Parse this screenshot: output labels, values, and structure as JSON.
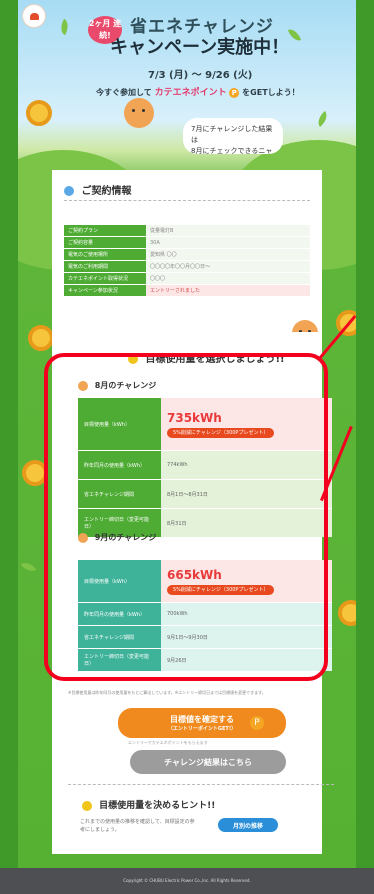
{
  "campaign": {
    "badge": "2ヶ月 連続!",
    "title_line1": "省エネチャレンジ",
    "title_line2": "キャンペーン実施中！",
    "period": "7/3 (月) 〜 9/26 (火)",
    "cta_prefix": "今すぐ参加して",
    "cta_highlight": "カテエネポイント",
    "cta_point": "P",
    "cta_suffix": "をGETしよう！",
    "bubble_line1": "7月にチャレンジした結果は",
    "bubble_line2": "8月にチェックできるニャ"
  },
  "contract": {
    "heading": "ご契約情報",
    "rows": [
      {
        "label": "ご契約プラン",
        "value": "従量電灯B"
      },
      {
        "label": "ご契約容量",
        "value": "30A"
      },
      {
        "label": "電気のご使用場所",
        "value": "愛知県 〇〇"
      },
      {
        "label": "電気のご利用期間",
        "value": "〇〇〇〇年〇〇月〇〇日〜"
      },
      {
        "label": "カテエネポイント取得状況",
        "value": "〇〇〇"
      },
      {
        "label": "キャンペーン参加状況",
        "value": "エントリーされました"
      }
    ]
  },
  "select": {
    "heading": "目標使用量を選択しましょう!!"
  },
  "august": {
    "heading": "8月のチャレンジ",
    "target_label": "目標使用量（kWh）",
    "target_value": "735kWh",
    "chip": "5%削減にチャレンジ（300Pプレゼント）",
    "rows": [
      {
        "label": "昨年同月の使用量（kWh）",
        "value": "774kWh"
      },
      {
        "label": "省エネチャレンジ期間",
        "value": "8月1日〜8月31日"
      },
      {
        "label": "エントリー締切日（変更可能日）",
        "value": "8月31日"
      }
    ]
  },
  "september": {
    "heading": "9月のチャレンジ",
    "target_label": "目標使用量（kWh）",
    "target_value": "665kWh",
    "chip": "5%削減にチャレンジ（300Pプレゼント）",
    "rows": [
      {
        "label": "昨年同月の使用量（kWh）",
        "value": "700kWh"
      },
      {
        "label": "省エネチャレンジ期間",
        "value": "9月1日〜9月30日"
      },
      {
        "label": "エントリー締切日（変更可能日）",
        "value": "9月26日"
      }
    ]
  },
  "notes": "※目標使用量は昨年同月の使用量をもとに算出しています。※エントリー締切日までは目標値を変更できます。",
  "buttons": {
    "confirm_line1": "目標値を確定する",
    "confirm_line2": "（エントリーポイントGET!）",
    "confirm_sub": "エントリーでカテエネポイントをもらえます",
    "confirm_point": "P",
    "results": "チャレンジ結果はこちら"
  },
  "hint": {
    "heading": "目標使用量を決めるヒント!!",
    "text": "これまでの使用量の推移を確認して、目標設定の参考にしましょう。",
    "button": "月別の推移"
  },
  "footer": {
    "copyright": "Copyright © CHUBU Electric Power Co.,Inc. All Rights Reserved."
  },
  "colors": {
    "green": "#4eab33",
    "teal": "#3fb39a",
    "orange": "#f08a1e",
    "red_annotation": "#f2001e"
  }
}
